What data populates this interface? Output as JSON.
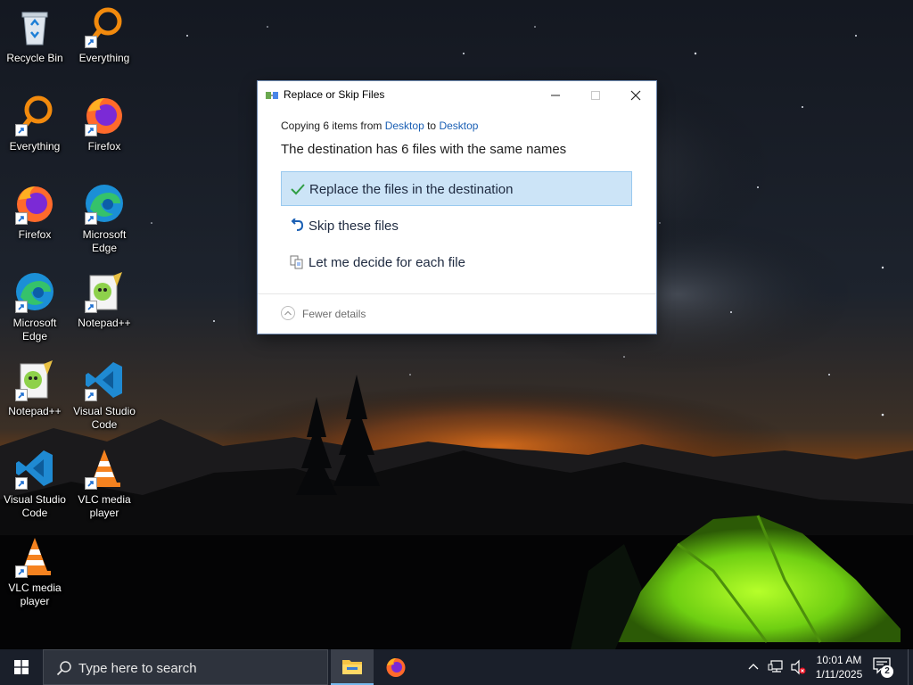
{
  "desktop": {
    "icons": [
      {
        "label": "Recycle Bin",
        "icon": "recycle-bin-icon"
      },
      {
        "label": "Everything",
        "icon": "everything-icon"
      },
      {
        "label": "Everything",
        "icon": "everything-icon"
      },
      {
        "label": "Firefox",
        "icon": "firefox-icon"
      },
      {
        "label": "Firefox",
        "icon": "firefox-icon"
      },
      {
        "label": "Microsoft Edge",
        "icon": "edge-icon"
      },
      {
        "label": "Microsoft Edge",
        "icon": "edge-icon"
      },
      {
        "label": "Notepad++",
        "icon": "notepadpp-icon"
      },
      {
        "label": "Notepad++",
        "icon": "notepadpp-icon"
      },
      {
        "label": "Visual Studio Code",
        "icon": "vscode-icon"
      },
      {
        "label": "Visual Studio Code",
        "icon": "vscode-icon"
      },
      {
        "label": "VLC media player",
        "icon": "vlc-icon"
      },
      {
        "label": "VLC media player",
        "icon": "vlc-icon"
      }
    ]
  },
  "dialog": {
    "title": "Replace or Skip Files",
    "copy_prefix": "Copying 6 items from",
    "copy_source": "Desktop",
    "copy_to": "to",
    "copy_dest": "Desktop",
    "heading": "The destination has 6 files with the same names",
    "options": [
      {
        "label": "Replace the files in the destination",
        "icon": "checkmark-icon",
        "selected": true
      },
      {
        "label": "Skip these files",
        "icon": "undo-arrow-icon",
        "selected": false
      },
      {
        "label": "Let me decide for each file",
        "icon": "compare-files-icon",
        "selected": false
      }
    ],
    "details_toggle": "Fewer details",
    "accent_color": "#cce4f7"
  },
  "taskbar": {
    "search_placeholder": "Type here to search",
    "apps": [
      {
        "name": "File Explorer",
        "icon": "folder-icon",
        "active": true
      },
      {
        "name": "Firefox",
        "icon": "firefox-icon",
        "active": false
      }
    ],
    "clock_time": "10:01 AM",
    "clock_date": "1/11/2025",
    "notification_count": "2"
  }
}
